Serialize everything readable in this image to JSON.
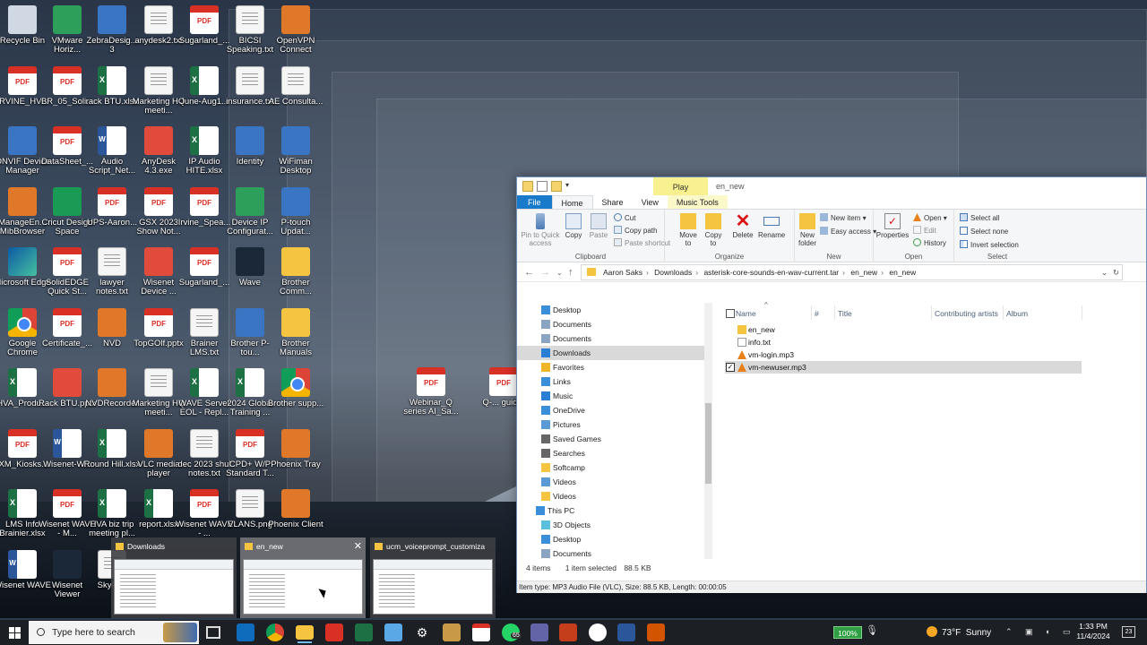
{
  "desktop": {
    "icons": [
      {
        "label": "Recycle Bin",
        "type": "bin"
      },
      {
        "label": "VMware Horiz...",
        "type": "green"
      },
      {
        "label": "ZebraDesig... 3",
        "type": "app"
      },
      {
        "label": "anydesk2.txt",
        "type": "txt"
      },
      {
        "label": "Sugarland_...",
        "type": "pdf"
      },
      {
        "label": "BICSI Speaking.txt",
        "type": "txt"
      },
      {
        "label": "OpenVPN Connect",
        "type": "orange"
      },
      {
        "label": "IRVINE_HV...",
        "type": "pdf"
      },
      {
        "label": "BR_05_Soli...",
        "type": "pdf"
      },
      {
        "label": "rack BTU.xlsx",
        "type": "xls"
      },
      {
        "label": "Marketing HQ meeti...",
        "type": "txt"
      },
      {
        "label": "June-Aug1...",
        "type": "xls"
      },
      {
        "label": "insurance.txt",
        "type": "txt"
      },
      {
        "label": "AE Consulta...",
        "type": "txt"
      },
      {
        "label": "ONVIF Device Manager",
        "type": "app"
      },
      {
        "label": "DataSheet_...",
        "type": "pdf"
      },
      {
        "label": "Audio Script_Net...",
        "type": "doc"
      },
      {
        "label": "AnyDesk 4.3.exe",
        "type": "red"
      },
      {
        "label": "IP Audio HITE.xlsx",
        "type": "xls"
      },
      {
        "label": "Identity",
        "type": "app"
      },
      {
        "label": "WiFiman Desktop",
        "type": "app"
      },
      {
        "label": "ManageEn... MibBrowser",
        "type": "orange"
      },
      {
        "label": "Cricut Design Space",
        "type": "cricut"
      },
      {
        "label": "UPS-Aaron...",
        "type": "pdf"
      },
      {
        "label": "GSX 2023 Show Not...",
        "type": "pdf"
      },
      {
        "label": "Irvine_Spea...",
        "type": "pdf"
      },
      {
        "label": "Device IP Configurat...",
        "type": "green"
      },
      {
        "label": "P-touch Updat...",
        "type": "app"
      },
      {
        "label": "Microsoft Edge",
        "type": "edge"
      },
      {
        "label": "SolidEDGE Quick St...",
        "type": "pdf"
      },
      {
        "label": "lawyer notes.txt",
        "type": "txt"
      },
      {
        "label": "Wisenet Device ...",
        "type": "red"
      },
      {
        "label": "Sugarland_...",
        "type": "pdf"
      },
      {
        "label": "Wave",
        "type": "dark"
      },
      {
        "label": "Brother Comm...",
        "type": "folder"
      },
      {
        "label": "Google Chrome",
        "type": "chrome"
      },
      {
        "label": "Certificate_...",
        "type": "pdf"
      },
      {
        "label": "NVD",
        "type": "orange"
      },
      {
        "label": "TopGOlf.pptx",
        "type": "pdf"
      },
      {
        "label": "Brainer LMS.txt",
        "type": "txt"
      },
      {
        "label": "Brother P-tou...",
        "type": "app"
      },
      {
        "label": "Brother Manuals",
        "type": "folder"
      },
      {
        "label": "HVA_Produ...",
        "type": "xls"
      },
      {
        "label": "Rack BTU.pptx",
        "type": "red"
      },
      {
        "label": "NVDRecorder",
        "type": "orange"
      },
      {
        "label": "Marketing HQ meeti...",
        "type": "txt"
      },
      {
        "label": "WAVE Server EOL - Repl...",
        "type": "xls"
      },
      {
        "label": "2024 Global Training ...",
        "type": "xls"
      },
      {
        "label": "Brother supp...",
        "type": "chrome"
      },
      {
        "label": "IXM_Kiosks...",
        "type": "pdf"
      },
      {
        "label": "Wisenet-W...",
        "type": "doc"
      },
      {
        "label": "Round Hill.xlsx",
        "type": "xls"
      },
      {
        "label": "VLC media player",
        "type": "orange"
      },
      {
        "label": "dec 2023 shul notes.txt",
        "type": "txt"
      },
      {
        "label": "CPD+ W/P Standard T...",
        "type": "pdf"
      },
      {
        "label": "Phoenix Tray",
        "type": "orange"
      },
      {
        "label": "LMS Info Brainier.xlsx",
        "type": "xls"
      },
      {
        "label": "Wisenet WAVE - M...",
        "type": "pdf"
      },
      {
        "label": "HVA biz trip meeting pl...",
        "type": "xls"
      },
      {
        "label": "report.xlsx",
        "type": "xls"
      },
      {
        "label": "Wisenet WAVE - ...",
        "type": "pdf"
      },
      {
        "label": "VLANS.png",
        "type": "txt"
      },
      {
        "label": "Phoenix Client",
        "type": "orange"
      },
      {
        "label": "Wisenet WAVE",
        "type": "doc"
      },
      {
        "label": "Wisenet Viewer",
        "type": "dark"
      },
      {
        "label": "SkyPr...",
        "type": "txt"
      },
      {
        "label": "Webinar_Q series AI_Sa...",
        "type": "pdf"
      },
      {
        "label": "Q-... guid...",
        "type": "pdf"
      }
    ]
  },
  "explorer": {
    "qat_dropdown": "▾",
    "context_tab": "Play",
    "title": "en_new",
    "tabs": {
      "file": "File",
      "home": "Home",
      "share": "Share",
      "view": "View",
      "music": "Music Tools"
    },
    "ribbon": {
      "pin": "Pin to Quick access",
      "copy": "Copy",
      "paste": "Paste",
      "cut": "Cut",
      "copy_path": "Copy path",
      "paste_shortcut": "Paste shortcut",
      "clipboard": "Clipboard",
      "move_to": "Move to",
      "copy_to": "Copy to",
      "delete": "Delete",
      "rename": "Rename",
      "organize": "Organize",
      "new_folder": "New folder",
      "new_item": "New item",
      "easy_access": "Easy access",
      "new": "New",
      "properties": "Properties",
      "open_btn": "Open",
      "edit": "Edit",
      "history": "History",
      "open": "Open",
      "select_all": "Select all",
      "select_none": "Select none",
      "invert_selection": "Invert selection",
      "select": "Select"
    },
    "address": [
      "Aaron Saks",
      "Downloads",
      "asterisk-core-sounds-en-wav-current.tar",
      "en_new",
      "en_new"
    ],
    "nav": [
      {
        "label": "Desktop",
        "color": "#3b8fd9"
      },
      {
        "label": "Documents",
        "color": "#8aa4c2"
      },
      {
        "label": "Documents",
        "color": "#8aa4c2"
      },
      {
        "label": "Downloads",
        "color": "#2a7fd4"
      },
      {
        "label": "Favorites",
        "color": "#f0b429"
      },
      {
        "label": "Links",
        "color": "#3b8fd9"
      },
      {
        "label": "Music",
        "color": "#2a7fd4"
      },
      {
        "label": "OneDrive",
        "color": "#3b8fd9"
      },
      {
        "label": "Pictures",
        "color": "#5b9bd5"
      },
      {
        "label": "Saved Games",
        "color": "#666666"
      },
      {
        "label": "Searches",
        "color": "#666666"
      },
      {
        "label": "Softcamp",
        "color": "#f5c542"
      },
      {
        "label": "Videos",
        "color": "#5b9bd5"
      },
      {
        "label": "Videos",
        "color": "#f5c542"
      },
      {
        "label": "This PC",
        "color": "#3b8fd9"
      },
      {
        "label": "3D Objects",
        "color": "#5bc0de"
      },
      {
        "label": "Desktop",
        "color": "#3b8fd9"
      },
      {
        "label": "Documents",
        "color": "#8aa4c2"
      }
    ],
    "columns": {
      "name": "Name",
      "num": "#",
      "title": "Title",
      "artists": "Contributing artists",
      "album": "Album"
    },
    "files": [
      {
        "name": "en_new",
        "kind": "folder"
      },
      {
        "name": "info.txt",
        "kind": "txt"
      },
      {
        "name": "vm-login.mp3",
        "kind": "vlc"
      },
      {
        "name": "vm-newuser.mp3",
        "kind": "vlc"
      }
    ],
    "checkmark": "✓",
    "status": {
      "items": "4 items",
      "selected": "1 item selected",
      "size": "88.5 KB"
    },
    "vlc_info": "Item type: MP3 Audio File (VLC), Size: 88.5 KB, Length: 00:00:05"
  },
  "thumbnails": [
    {
      "title": "Downloads"
    },
    {
      "title": "en_new",
      "close": "✕"
    },
    {
      "title": "ucm_voiceprompt_customizati..."
    }
  ],
  "taskbar": {
    "search_placeholder": "Type here to search",
    "battery": "100%",
    "weather_temp": "73°F",
    "weather_cond": "Sunny",
    "time": "1:33 PM",
    "date": "11/4/2024",
    "badge": "65",
    "notifications": "23"
  }
}
